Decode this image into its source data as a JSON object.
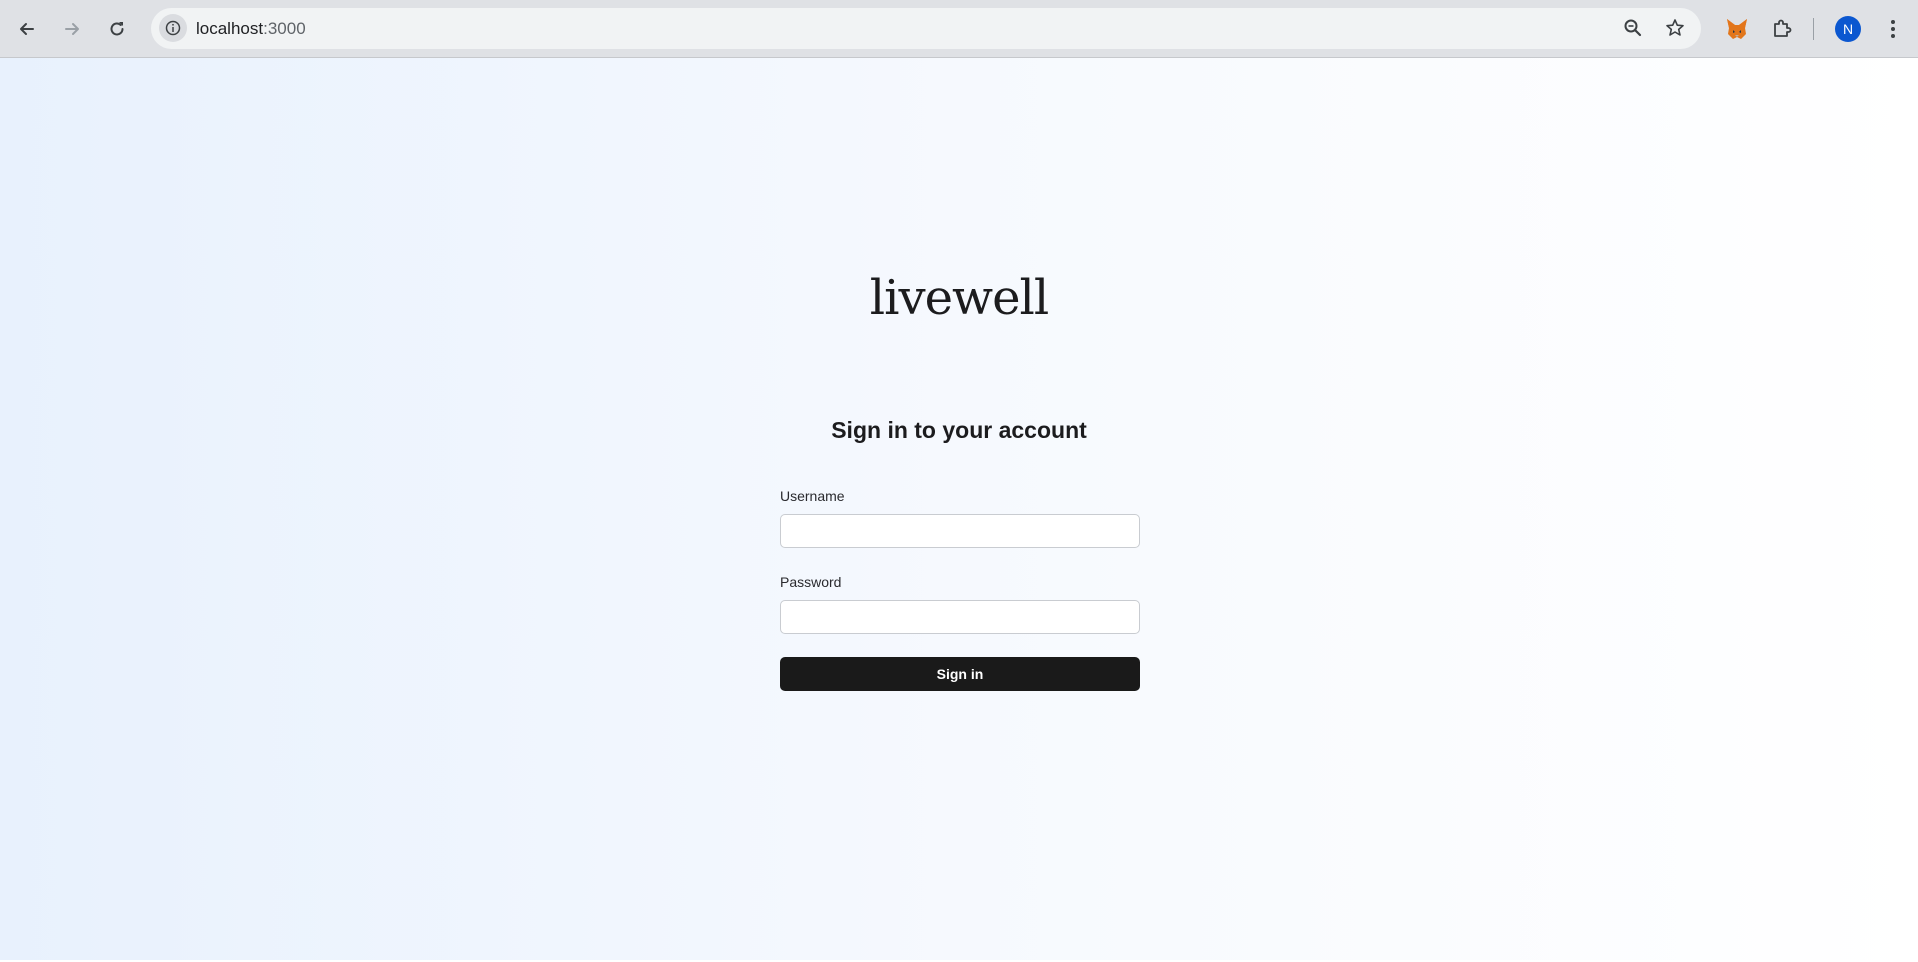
{
  "browser": {
    "url_host": "localhost",
    "url_port": ":3000",
    "profile_initial": "N",
    "accent_color": "#0b57d0"
  },
  "icons": {
    "back": "back-arrow-icon",
    "forward": "forward-arrow-icon",
    "reload": "reload-icon",
    "site_info": "info-icon",
    "zoom": "zoom-icon",
    "bookmark": "star-icon",
    "extension_fox": "metamask-fox-icon",
    "extensions": "puzzle-icon",
    "menu": "kebab-menu-icon"
  },
  "page": {
    "logo": "livewell",
    "heading": "Sign in to your account",
    "username_label": "Username",
    "username_value": "",
    "password_label": "Password",
    "password_value": "",
    "submit_label": "Sign in",
    "button_color": "#1a1a1a",
    "background_start": "#e8f1fd",
    "background_end": "#ffffff"
  }
}
